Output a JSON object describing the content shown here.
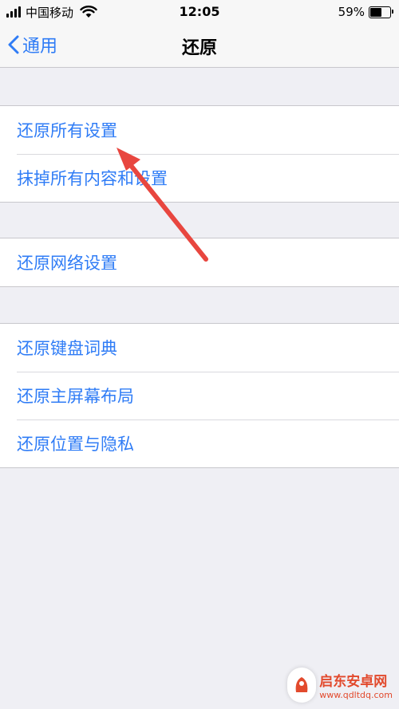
{
  "status_bar": {
    "carrier": "中国移动",
    "time": "12:05",
    "battery_percent": "59%",
    "battery_level": 0.59,
    "icons": [
      "signal-icon",
      "wifi-icon",
      "battery-icon"
    ]
  },
  "nav": {
    "back_label": "通用",
    "title": "还原"
  },
  "groups": [
    {
      "items": [
        "还原所有设置",
        "抹掉所有内容和设置"
      ]
    },
    {
      "items": [
        "还原网络设置"
      ]
    },
    {
      "items": [
        "还原键盘词典",
        "还原主屏幕布局",
        "还原位置与隐私"
      ]
    }
  ],
  "watermark": {
    "name": "启东安卓网",
    "url": "www.qdltdq.com"
  },
  "colors": {
    "accent": "#2f7cf6",
    "background": "#efeff4",
    "annotation_arrow": "#e8463f"
  }
}
